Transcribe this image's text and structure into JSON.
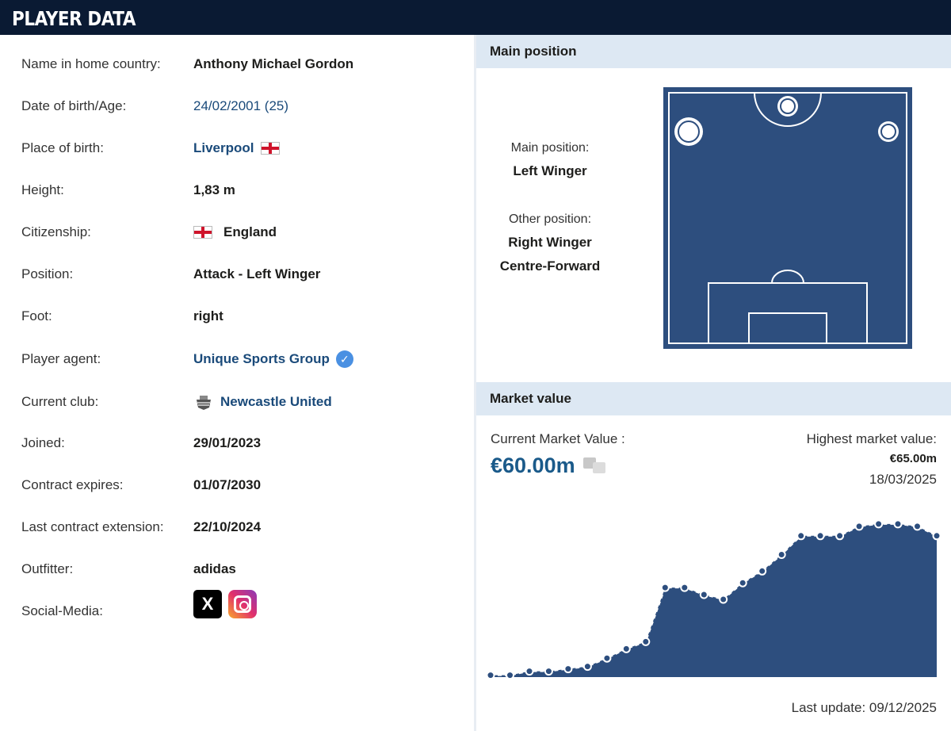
{
  "header": {
    "title": "PLAYER DATA"
  },
  "player": {
    "rows": [
      {
        "label": "Name in home country:",
        "value": "Anthony Michael Gordon"
      },
      {
        "label": "Date of birth/Age:",
        "value": "24/02/2001 (25)"
      },
      {
        "label": "Place of birth:",
        "value": "Liverpool"
      },
      {
        "label": "Height:",
        "value": "1,83 m"
      },
      {
        "label": "Citizenship:",
        "value": "England"
      },
      {
        "label": "Position:",
        "value": "Attack - Left Winger"
      },
      {
        "label": "Foot:",
        "value": "right"
      },
      {
        "label": "Player agent:",
        "value": "Unique Sports Group"
      },
      {
        "label": "Current club:",
        "value": "Newcastle United"
      },
      {
        "label": "Joined:",
        "value": "29/01/2023"
      },
      {
        "label": "Contract expires:",
        "value": "01/07/2030"
      },
      {
        "label": "Last contract extension:",
        "value": "22/10/2024"
      },
      {
        "label": "Outfitter:",
        "value": "adidas"
      },
      {
        "label": "Social-Media:",
        "value": ""
      }
    ],
    "social": {
      "x_glyph": "X"
    }
  },
  "main_position": {
    "heading": "Main position",
    "main_label": "Main position:",
    "main_value": "Left Winger",
    "other_label": "Other position:",
    "other_values": [
      "Right Winger",
      "Centre-Forward"
    ]
  },
  "market_value": {
    "heading": "Market value",
    "current_label": "Current Market Value :",
    "current_value": "€60.00m",
    "highest_label": "Highest market value:",
    "highest_value": "€65.00m",
    "highest_date": "18/03/2025",
    "last_update": "Last update: 09/12/2025"
  },
  "colors": {
    "header_bg": "#0a1a33",
    "section_bg": "#dde8f3",
    "pitch": "#2d4e7e",
    "chart_fill": "#2d4e7e",
    "link": "#1a4a7a",
    "value_blue": "#1a5a8a"
  },
  "chart_data": {
    "type": "area",
    "title": "",
    "xlabel": "",
    "ylabel": "",
    "ylim": [
      0,
      68
    ],
    "series": [
      {
        "values": [
          0.8,
          0.8,
          2.5,
          2.5,
          3.5,
          4.5,
          8,
          12,
          15,
          38,
          38,
          35,
          33,
          40,
          45,
          52,
          60,
          60,
          60,
          64,
          65,
          65,
          64,
          60
        ]
      }
    ]
  }
}
